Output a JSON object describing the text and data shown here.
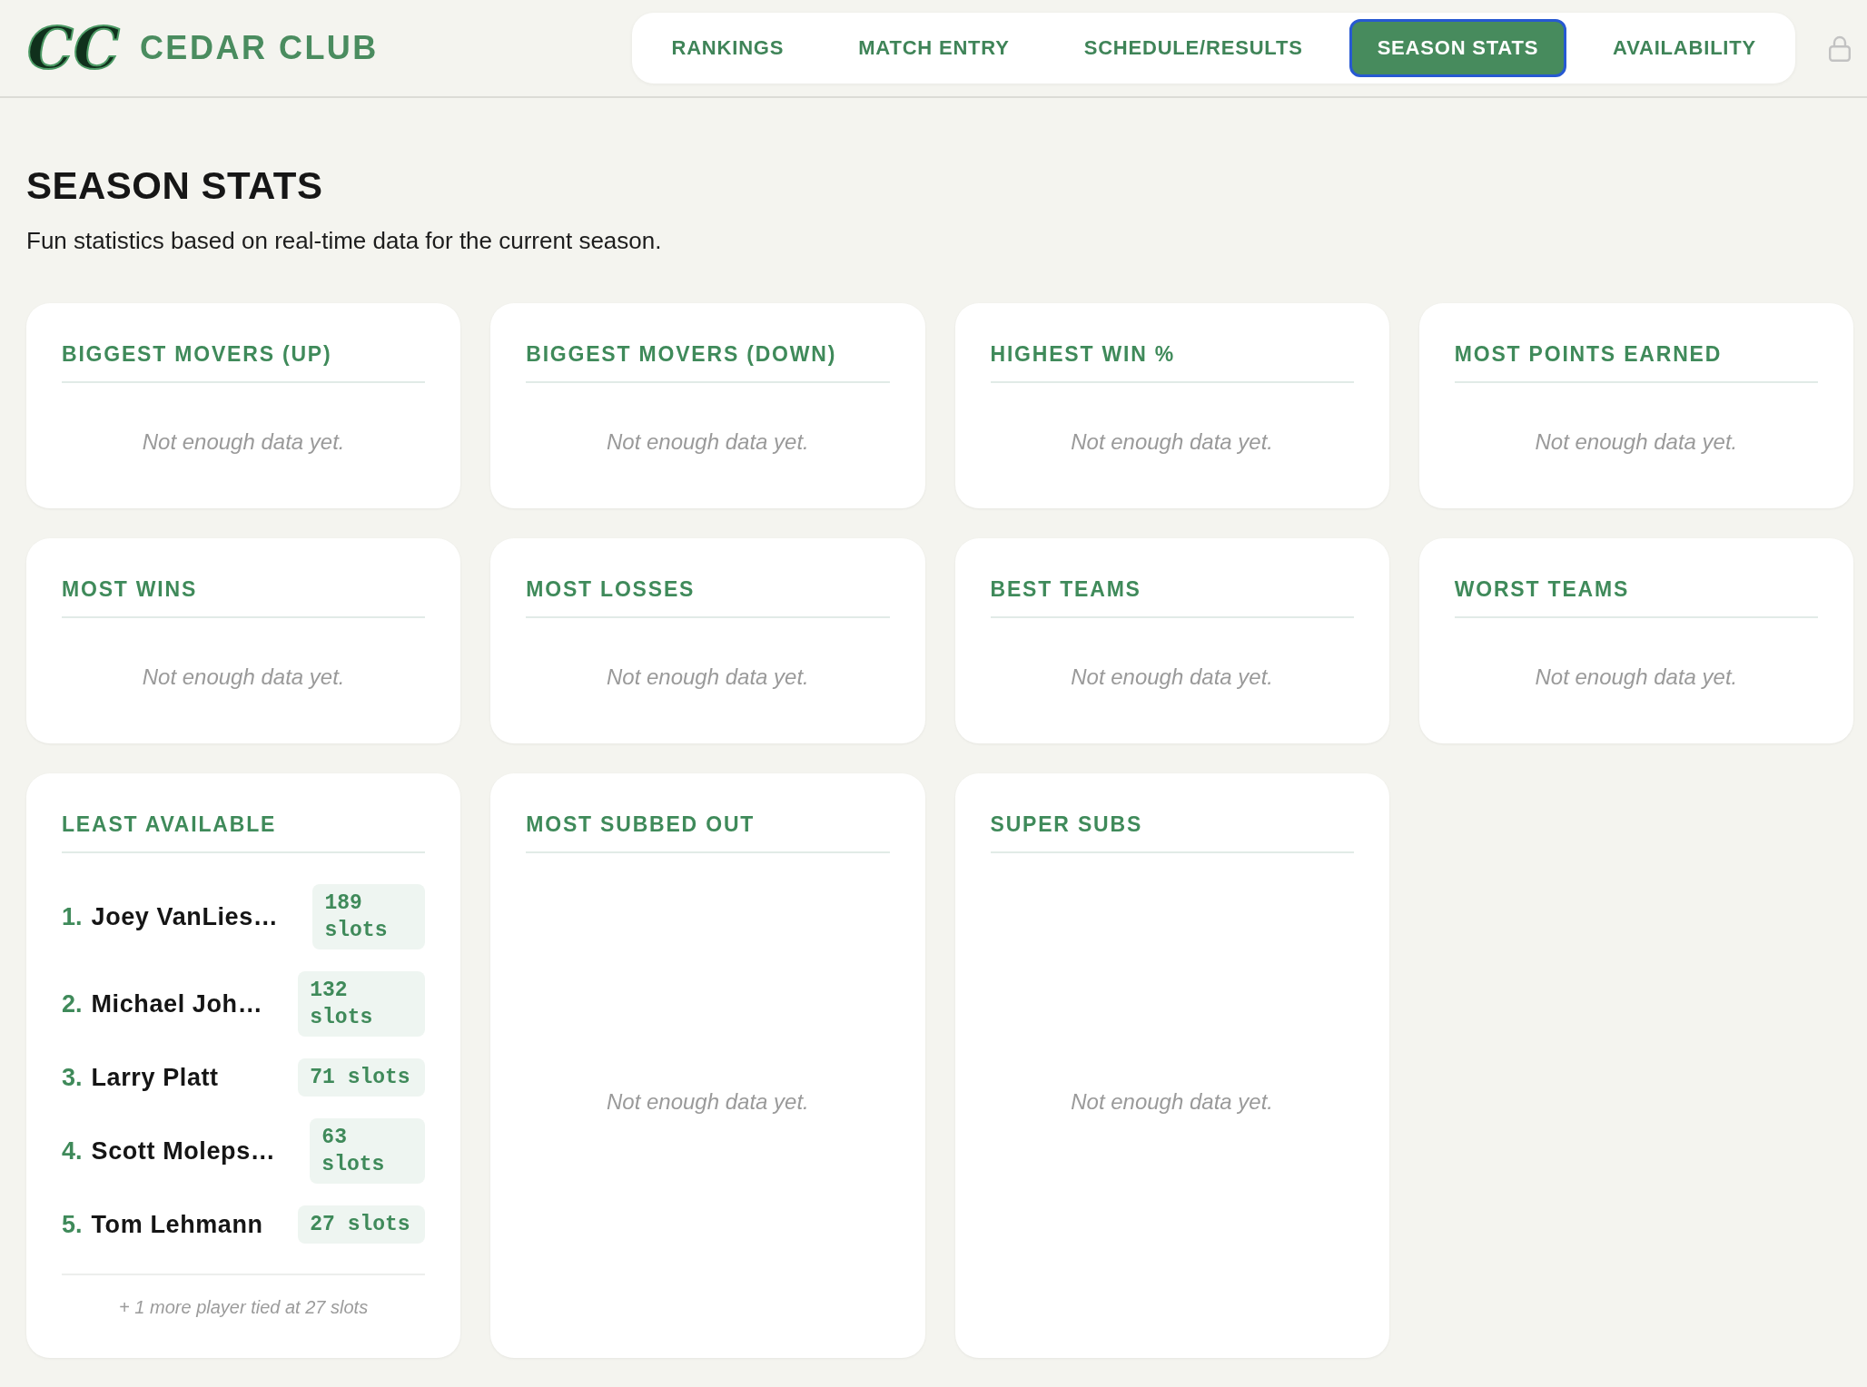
{
  "header": {
    "logo_mark": "CC",
    "site_name": "CEDAR CLUB",
    "nav": [
      {
        "label": "RANKINGS",
        "selected": false
      },
      {
        "label": "MATCH ENTRY",
        "selected": false
      },
      {
        "label": "SCHEDULE/RESULTS",
        "selected": false
      },
      {
        "label": "SEASON STATS",
        "selected": true
      },
      {
        "label": "AVAILABILITY",
        "selected": false
      }
    ]
  },
  "page": {
    "title": "SEASON STATS",
    "subtitle": "Fun statistics based on real-time data for the current season."
  },
  "cards": [
    {
      "title": "BIGGEST MOVERS (UP)",
      "kind": "empty",
      "message": "Not enough data yet."
    },
    {
      "title": "BIGGEST MOVERS (DOWN)",
      "kind": "empty",
      "message": "Not enough data yet."
    },
    {
      "title": "HIGHEST WIN %",
      "kind": "empty",
      "message": "Not enough data yet."
    },
    {
      "title": "MOST POINTS EARNED",
      "kind": "empty",
      "message": "Not enough data yet."
    },
    {
      "title": "MOST WINS",
      "kind": "empty",
      "message": "Not enough data yet."
    },
    {
      "title": "MOST LOSSES",
      "kind": "empty",
      "message": "Not enough data yet."
    },
    {
      "title": "BEST TEAMS",
      "kind": "empty",
      "message": "Not enough data yet."
    },
    {
      "title": "WORST TEAMS",
      "kind": "empty",
      "message": "Not enough data yet."
    },
    {
      "title": "LEAST AVAILABLE",
      "kind": "list",
      "items": [
        {
          "rank": "1.",
          "name": "Joey VanLies…",
          "count": "189 slots"
        },
        {
          "rank": "2.",
          "name": "Michael Joh…",
          "count": "132 slots"
        },
        {
          "rank": "3.",
          "name": "Larry Platt",
          "count": "71 slots"
        },
        {
          "rank": "4.",
          "name": "Scott Moleps…",
          "count": "63 slots"
        },
        {
          "rank": "5.",
          "name": "Tom Lehmann",
          "count": "27 slots"
        }
      ],
      "footer": "+ 1 more player tied at 27 slots"
    },
    {
      "title": "MOST SUBBED OUT",
      "kind": "empty",
      "message": "Not enough data yet."
    },
    {
      "title": "SUPER SUBS",
      "kind": "empty",
      "message": "Not enough data yet."
    }
  ]
}
